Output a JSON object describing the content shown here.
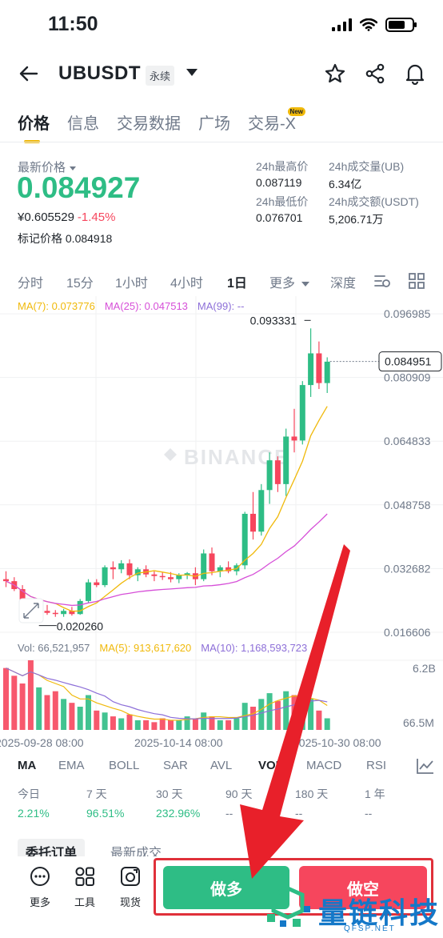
{
  "status_bar": {
    "time": "11:50"
  },
  "header": {
    "symbol": "UBUSDT",
    "contract_tag": "永续"
  },
  "tabs": [
    {
      "label": "价格",
      "active": true
    },
    {
      "label": "信息",
      "active": false
    },
    {
      "label": "交易数据",
      "active": false
    },
    {
      "label": "广场",
      "active": false
    },
    {
      "label": "交易-X",
      "active": false,
      "badge": "New"
    }
  ],
  "ticker": {
    "latest_label": "最新价格",
    "last_price": "0.084927",
    "cny_price": "¥0.605529",
    "change_pct": "-1.45%",
    "mark_label": "标记价格",
    "mark_price": "0.084918",
    "high_label": "24h最高价",
    "high": "0.087119",
    "low_label": "24h最低价",
    "low": "0.076701",
    "vol_label": "24h成交量(UB)",
    "vol": "6.34亿",
    "turnover_label": "24h成交额(USDT)",
    "turnover": "5,206.71万"
  },
  "intervals": {
    "items": [
      "分时",
      "15分",
      "1小时",
      "4小时",
      "1日"
    ],
    "active": "1日",
    "more": "更多",
    "depth": "深度"
  },
  "ma_legend": {
    "ma7": "MA(7): 0.073776",
    "ma25": "MA(25): 0.047513",
    "ma99": "MA(99): --"
  },
  "vol_legend": {
    "vol": "Vol: 66,521,957",
    "ma5": "MA(5): 913,617,620",
    "ma10": "MA(10): 1,168,593,723"
  },
  "colors": {
    "up": "#2ebd85",
    "down": "#f6465d",
    "ma7": "#f0b90b",
    "ma25": "#d64fd8",
    "ma99": "#8d6fd8",
    "accent": "#f0b90b"
  },
  "chart_data": {
    "type": "candlestick",
    "y_ticks": [
      "0.096985",
      "0.080909",
      "0.064833",
      "0.048758",
      "0.032682",
      "0.016606"
    ],
    "x_ticks": [
      "2025-09-28 08:00",
      "2025-10-14 08:00",
      "2025-10-30 08:00"
    ],
    "high_label": "0.093331",
    "low_label": "0.020260",
    "current_price_label": "0.084951",
    "volume_ticks": [
      "6.2B",
      "66.5M"
    ],
    "watermark": "BINANCE",
    "candles": [
      {
        "o": 0.03,
        "h": 0.032,
        "l": 0.028,
        "c": 0.0295
      },
      {
        "o": 0.0295,
        "h": 0.0305,
        "l": 0.027,
        "c": 0.0275
      },
      {
        "o": 0.0275,
        "h": 0.0285,
        "l": 0.023,
        "c": 0.024
      },
      {
        "o": 0.024,
        "h": 0.025,
        "l": 0.0205,
        "c": 0.0215
      },
      {
        "o": 0.0215,
        "h": 0.023,
        "l": 0.0203,
        "c": 0.022
      },
      {
        "o": 0.022,
        "h": 0.0235,
        "l": 0.021,
        "c": 0.0215
      },
      {
        "o": 0.0215,
        "h": 0.0222,
        "l": 0.0205,
        "c": 0.0212
      },
      {
        "o": 0.0212,
        "h": 0.0225,
        "l": 0.0205,
        "c": 0.022
      },
      {
        "o": 0.022,
        "h": 0.023,
        "l": 0.0208,
        "c": 0.0212
      },
      {
        "o": 0.0212,
        "h": 0.025,
        "l": 0.021,
        "c": 0.0245
      },
      {
        "o": 0.0245,
        "h": 0.03,
        "l": 0.024,
        "c": 0.0292
      },
      {
        "o": 0.0292,
        "h": 0.03,
        "l": 0.028,
        "c": 0.0285
      },
      {
        "o": 0.0285,
        "h": 0.0335,
        "l": 0.028,
        "c": 0.033
      },
      {
        "o": 0.033,
        "h": 0.0345,
        "l": 0.03,
        "c": 0.0325
      },
      {
        "o": 0.0325,
        "h": 0.0348,
        "l": 0.0315,
        "c": 0.034
      },
      {
        "o": 0.034,
        "h": 0.035,
        "l": 0.03,
        "c": 0.031
      },
      {
        "o": 0.031,
        "h": 0.033,
        "l": 0.0295,
        "c": 0.0325
      },
      {
        "o": 0.0325,
        "h": 0.0335,
        "l": 0.0305,
        "c": 0.0312
      },
      {
        "o": 0.0312,
        "h": 0.032,
        "l": 0.0295,
        "c": 0.0308
      },
      {
        "o": 0.0308,
        "h": 0.0318,
        "l": 0.0298,
        "c": 0.0305
      },
      {
        "o": 0.0305,
        "h": 0.0318,
        "l": 0.0292,
        "c": 0.03
      },
      {
        "o": 0.03,
        "h": 0.0315,
        "l": 0.029,
        "c": 0.031
      },
      {
        "o": 0.031,
        "h": 0.0318,
        "l": 0.03,
        "c": 0.0315
      },
      {
        "o": 0.0315,
        "h": 0.033,
        "l": 0.0285,
        "c": 0.03
      },
      {
        "o": 0.03,
        "h": 0.0375,
        "l": 0.0295,
        "c": 0.0365
      },
      {
        "o": 0.0365,
        "h": 0.038,
        "l": 0.031,
        "c": 0.032
      },
      {
        "o": 0.032,
        "h": 0.0335,
        "l": 0.0305,
        "c": 0.033
      },
      {
        "o": 0.033,
        "h": 0.0345,
        "l": 0.0315,
        "c": 0.032
      },
      {
        "o": 0.032,
        "h": 0.034,
        "l": 0.031,
        "c": 0.0335
      },
      {
        "o": 0.0335,
        "h": 0.047,
        "l": 0.0325,
        "c": 0.0465
      },
      {
        "o": 0.0465,
        "h": 0.052,
        "l": 0.04,
        "c": 0.042
      },
      {
        "o": 0.042,
        "h": 0.054,
        "l": 0.041,
        "c": 0.0525
      },
      {
        "o": 0.0525,
        "h": 0.062,
        "l": 0.049,
        "c": 0.06
      },
      {
        "o": 0.06,
        "h": 0.061,
        "l": 0.052,
        "c": 0.054
      },
      {
        "o": 0.054,
        "h": 0.068,
        "l": 0.051,
        "c": 0.066
      },
      {
        "o": 0.066,
        "h": 0.073,
        "l": 0.062,
        "c": 0.065
      },
      {
        "o": 0.065,
        "h": 0.08,
        "l": 0.064,
        "c": 0.079
      },
      {
        "o": 0.079,
        "h": 0.0933,
        "l": 0.076,
        "c": 0.087
      },
      {
        "o": 0.087,
        "h": 0.09,
        "l": 0.078,
        "c": 0.0795
      },
      {
        "o": 0.0795,
        "h": 0.086,
        "l": 0.077,
        "c": 0.0849
      }
    ],
    "volumes": [
      3.2,
      2.8,
      2.4,
      3.6,
      2.2,
      1.8,
      2.0,
      1.6,
      1.4,
      1.2,
      1.8,
      1.0,
      0.9,
      0.7,
      0.6,
      0.8,
      0.5,
      0.5,
      0.4,
      0.6,
      0.5,
      0.5,
      0.7,
      0.6,
      0.9,
      0.7,
      0.5,
      0.5,
      0.6,
      1.4,
      1.2,
      1.6,
      1.9,
      1.5,
      2.0,
      1.8,
      1.3,
      1.6,
      1.0,
      0.6
    ],
    "ylim": [
      0.0166,
      0.097
    ]
  },
  "indicators": {
    "items": [
      "MA",
      "EMA",
      "BOLL",
      "SAR",
      "AVL",
      "VOL",
      "MACD",
      "RSI"
    ],
    "active_main": "MA",
    "active_sub": "VOL"
  },
  "performance": [
    {
      "label": "今日",
      "value": "2.21%"
    },
    {
      "label": "7 天",
      "value": "96.51%"
    },
    {
      "label": "30 天",
      "value": "232.96%"
    },
    {
      "label": "90 天",
      "value": "--"
    },
    {
      "label": "180 天",
      "value": "--"
    },
    {
      "label": "1 年",
      "value": "--"
    }
  ],
  "order_tabs": {
    "orders": "委托订单",
    "trades": "最新成交"
  },
  "bottom_bar": {
    "more": "更多",
    "tools": "工具",
    "spot": "现货",
    "long": "做多",
    "short": "做空"
  },
  "watermark": {
    "text": "量链科技",
    "sub": "QFSP.NET"
  }
}
